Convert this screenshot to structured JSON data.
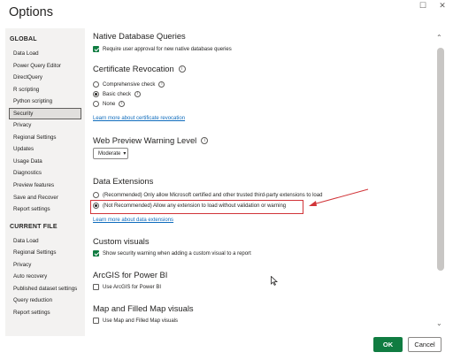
{
  "window": {
    "title": "Options",
    "restore_glyph": "☐",
    "close_glyph": "✕"
  },
  "sidebar": {
    "global_label": "GLOBAL",
    "global_items": [
      {
        "label": "Data Load"
      },
      {
        "label": "Power Query Editor"
      },
      {
        "label": "DirectQuery"
      },
      {
        "label": "R scripting"
      },
      {
        "label": "Python scripting"
      },
      {
        "label": "Security",
        "selected": true
      },
      {
        "label": "Privacy"
      },
      {
        "label": "Regional Settings"
      },
      {
        "label": "Updates"
      },
      {
        "label": "Usage Data"
      },
      {
        "label": "Diagnostics"
      },
      {
        "label": "Preview features"
      },
      {
        "label": "Save and Recover"
      },
      {
        "label": "Report settings"
      }
    ],
    "current_file_label": "CURRENT FILE",
    "current_file_items": [
      {
        "label": "Data Load"
      },
      {
        "label": "Regional Settings"
      },
      {
        "label": "Privacy"
      },
      {
        "label": "Auto recovery"
      },
      {
        "label": "Published dataset settings"
      },
      {
        "label": "Query reduction"
      },
      {
        "label": "Report settings"
      }
    ]
  },
  "content": {
    "native_db": {
      "title": "Native Database Queries",
      "checkbox_label": "Require user approval for new native database queries"
    },
    "cert_revocation": {
      "title": "Certificate Revocation",
      "options": [
        "Comprehensive check",
        "Basic check",
        "None"
      ],
      "link": "Learn more about certificate revocation"
    },
    "web_preview": {
      "title": "Web Preview Warning Level",
      "selected_value": "Moderate",
      "chevron": "▾"
    },
    "data_extensions": {
      "title": "Data Extensions",
      "option_recommended": "(Recommended) Only allow Microsoft certified and other trusted third-party extensions to load",
      "option_not_recommended": "(Not Recommended) Allow any extension to load without validation or warning",
      "link": "Learn more about data extensions"
    },
    "custom_visuals": {
      "title": "Custom visuals",
      "checkbox_label": "Show security warning when adding a custom visual to a report"
    },
    "arcgis": {
      "title": "ArcGIS for Power BI",
      "checkbox_label": "Use ArcGIS for Power BI"
    },
    "maps": {
      "title": "Map and Filled Map visuals",
      "checkbox_label": "Use Map and Filled Map visuals"
    }
  },
  "scroll": {
    "up_glyph": "⌃",
    "down_glyph": "⌄"
  },
  "buttons": {
    "ok": "OK",
    "cancel": "Cancel"
  },
  "colors": {
    "accent": "#107c41",
    "link": "#0f6cbd",
    "annotation": "#d13438"
  }
}
